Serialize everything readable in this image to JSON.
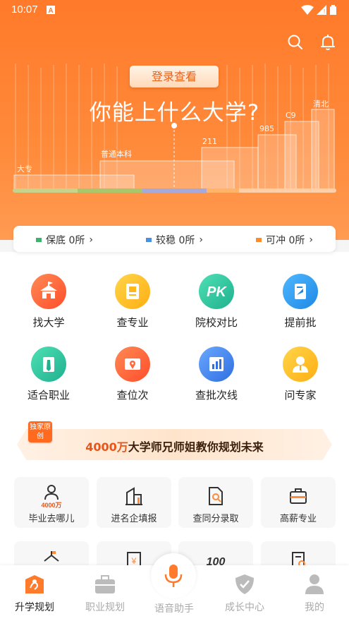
{
  "status": {
    "time": "10:07"
  },
  "hero": {
    "login_label": "登录查看",
    "headline": "你能上什么大学?",
    "levels": [
      "大专",
      "普通本科",
      "211",
      "985",
      "C9",
      "清北"
    ],
    "colors": {
      "bg": "#ff7a2a",
      "accent": "#e8611a"
    }
  },
  "summary": {
    "safe": "保底 0所",
    "stable": "较稳 0所",
    "reach": "可冲 0所",
    "colors": {
      "safe": "#3cb46e",
      "stable": "#4a90e2",
      "reach": "#ff8c2a"
    }
  },
  "features": [
    {
      "label": "找大学",
      "icon": "university-icon",
      "color": "#ff6a3d"
    },
    {
      "label": "查专业",
      "icon": "book-icon",
      "color": "#ffb81a"
    },
    {
      "label": "院校对比",
      "icon": "pk-icon",
      "color": "#2ec4a0"
    },
    {
      "label": "提前批",
      "icon": "document-icon",
      "color": "#2f9ff0"
    },
    {
      "label": "适合职业",
      "icon": "briefcase-icon",
      "color": "#2ec4a0"
    },
    {
      "label": "查位次",
      "icon": "location-icon",
      "color": "#ff6a3d"
    },
    {
      "label": "查批次线",
      "icon": "chart-icon",
      "color": "#3b8ff0"
    },
    {
      "label": "问专家",
      "icon": "expert-icon",
      "color": "#ffb81a"
    }
  ],
  "banner": {
    "badge": "独家原创",
    "number": "4000万",
    "text": "大学师兄师姐教你规划未来"
  },
  "cards": [
    {
      "label": "毕业去哪儿",
      "icon_text": "4000万"
    },
    {
      "label": "进名企填报"
    },
    {
      "label": "查同分录取"
    },
    {
      "label": "高薪专业"
    }
  ],
  "cards_row2": [
    {
      "icon_text": "100"
    }
  ],
  "tabs": [
    {
      "label": "升学规划"
    },
    {
      "label": "职业规划"
    },
    {
      "label": "语音助手"
    },
    {
      "label": "成长中心"
    },
    {
      "label": "我的"
    }
  ]
}
